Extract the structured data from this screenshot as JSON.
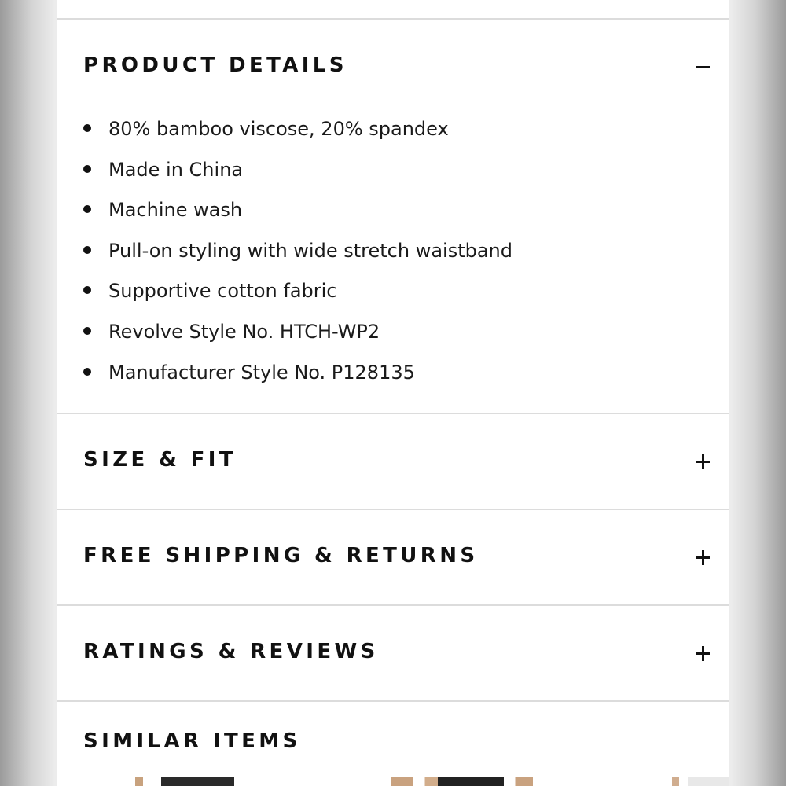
{
  "sections": {
    "product_details": {
      "title": "PRODUCT DETAILS",
      "toggle": "collapse",
      "items": [
        "80% bamboo viscose, 20% spandex",
        "Made in China",
        "Machine wash",
        "Pull-on styling with wide stretch waistband",
        "Supportive cotton fabric",
        "Revolve Style No. HTCH-WP2",
        "Manufacturer Style No. P128135"
      ]
    },
    "size_fit": {
      "title": "SIZE & FIT",
      "toggle": "expand"
    },
    "shipping_returns": {
      "title": "FREE SHIPPING & RETURNS",
      "toggle": "expand"
    },
    "ratings_reviews": {
      "title": "RATINGS & REVIEWS",
      "toggle": "expand"
    },
    "similar_items": {
      "title": "SIMILAR ITEMS"
    }
  },
  "icons": {
    "collapse": "minus-icon",
    "expand": "plus-icon"
  },
  "colors": {
    "text": "#111111",
    "divider": "#dcdcdc",
    "panel": "#ffffff"
  }
}
